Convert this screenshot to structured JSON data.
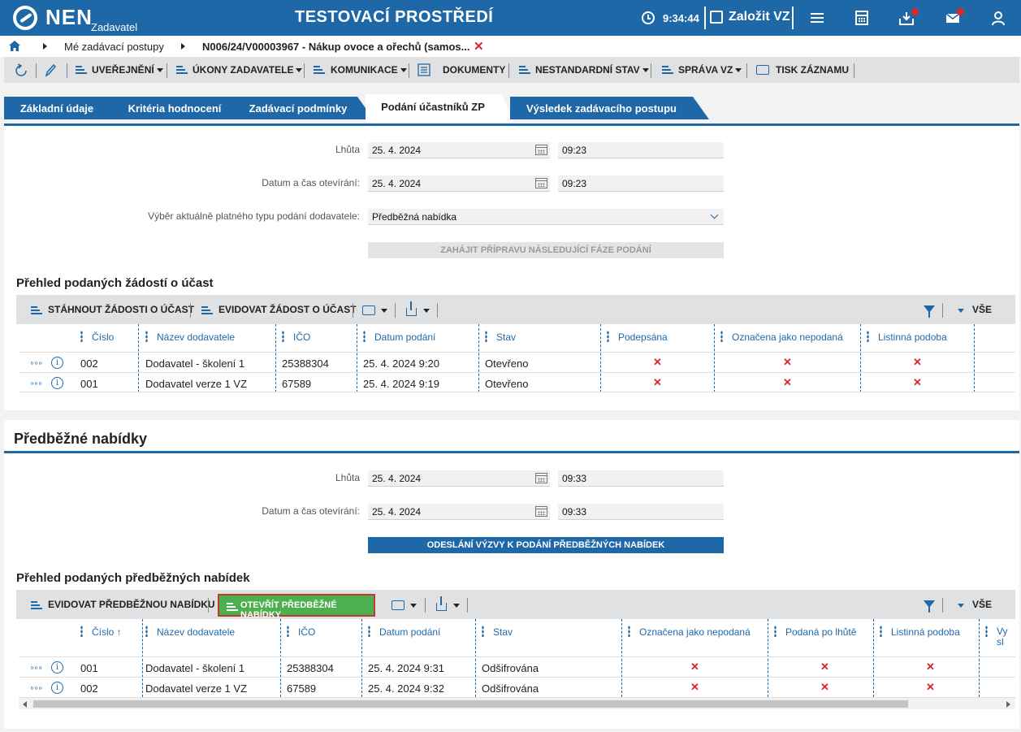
{
  "header": {
    "logo": "NEN",
    "logo_sub": "Zadavatel",
    "env_title": "TESTOVACÍ PROSTŘEDÍ",
    "clock": "9:34:44",
    "new_vz": "Založit VZ"
  },
  "breadcrumb": {
    "item1": "Mé zadávací postupy",
    "item2": "N006/24/V00003967 - Nákup ovoce a ořechů (samos...",
    "close": "✕"
  },
  "toolbar": {
    "uverejneni": "UVEŘEJNĚNÍ",
    "ukony": "ÚKONY ZADAVATELE",
    "komunikace": "KOMUNIKACE",
    "dokumenty": "DOKUMENTY",
    "nestandardni": "NESTANDARDNÍ STAV",
    "sprava": "SPRÁVA VZ",
    "tisk": "TISK ZÁZNAMU"
  },
  "tabs": [
    "Základní údaje",
    "Kritéria hodnocení",
    "Zadávací podmínky",
    "Podání účastníků ZP",
    "Výsledek zadávacího postupu"
  ],
  "sec1": {
    "lhuta_label": "Lhůta",
    "lhuta_date": "25. 4. 2024",
    "lhuta_time": "09:23",
    "open_label": "Datum a čas otevírání:",
    "open_date": "25. 4. 2024",
    "open_time": "09:23",
    "type_label": "Výběr aktuálně platného typu podání dodavatele:",
    "type_value": "Předběžná nabídka",
    "btn": "ZAHÁJIT PŘÍPRAVU NÁSLEDUJÍCÍ FÁZE PODÁNÍ",
    "grid_title": "Přehled podaných žádostí o účast",
    "tb_download": "STÁHNOUT ŽÁDOSTI O ÚČAST",
    "tb_register": "EVIDOVAT ŽÁDOST O ÚČAST",
    "tb_all": "VŠE",
    "columns": [
      "Číslo",
      "Název dodavatele",
      "IČO",
      "Datum podání",
      "Stav",
      "Podepsána",
      "Označena jako nepodaná",
      "Listinná podoba"
    ],
    "rows": [
      {
        "cislo": "002",
        "nazev": "Dodavatel - školení 1",
        "ico": "25388304",
        "datum": "25. 4. 2024 9:20",
        "stav": "Otevřeno",
        "x": "✕"
      },
      {
        "cislo": "001",
        "nazev": "Dodavatel verze 1 VZ",
        "ico": "67589",
        "datum": "25. 4. 2024 9:19",
        "stav": "Otevřeno",
        "x": "✕"
      }
    ]
  },
  "sec2": {
    "title": "Předběžné nabídky",
    "lhuta_label": "Lhůta",
    "lhuta_date": "25. 4. 2024",
    "lhuta_time": "09:33",
    "open_label": "Datum a čas otevírání:",
    "open_date": "25. 4. 2024",
    "open_time": "09:33",
    "btn": "ODESLÁNÍ VÝZVY K PODÁNÍ PŘEDBĚŽNÝCH NABÍDEK",
    "grid_title": "Přehled podaných předběžných nabídek",
    "tb_register": "EVIDOVAT PŘEDBĚŽNOU NABÍDKU",
    "tb_open": "OTEVŘÍT PŘEDBĚŽNÉ NABÍDKY",
    "tb_all": "VŠE",
    "columns": [
      "Číslo ↑",
      "Název dodavatele",
      "IČO",
      "Datum podání",
      "Stav",
      "Označena jako nepodaná",
      "Podaná po lhůtě",
      "Listinná podoba",
      "Vy",
      "sl"
    ],
    "rows": [
      {
        "cislo": "001",
        "nazev": "Dodavatel - školení 1",
        "ico": "25388304",
        "datum": "25. 4. 2024 9:31",
        "stav": "Odšifrována",
        "x": "✕"
      },
      {
        "cislo": "002",
        "nazev": "Dodavatel verze 1 VZ",
        "ico": "67589",
        "datum": "25. 4. 2024 9:32",
        "stav": "Odšifrována",
        "x": "✕"
      }
    ]
  },
  "colors": {
    "primary": "#1f68a8",
    "green": "#4caf50",
    "red": "#d7262b"
  }
}
